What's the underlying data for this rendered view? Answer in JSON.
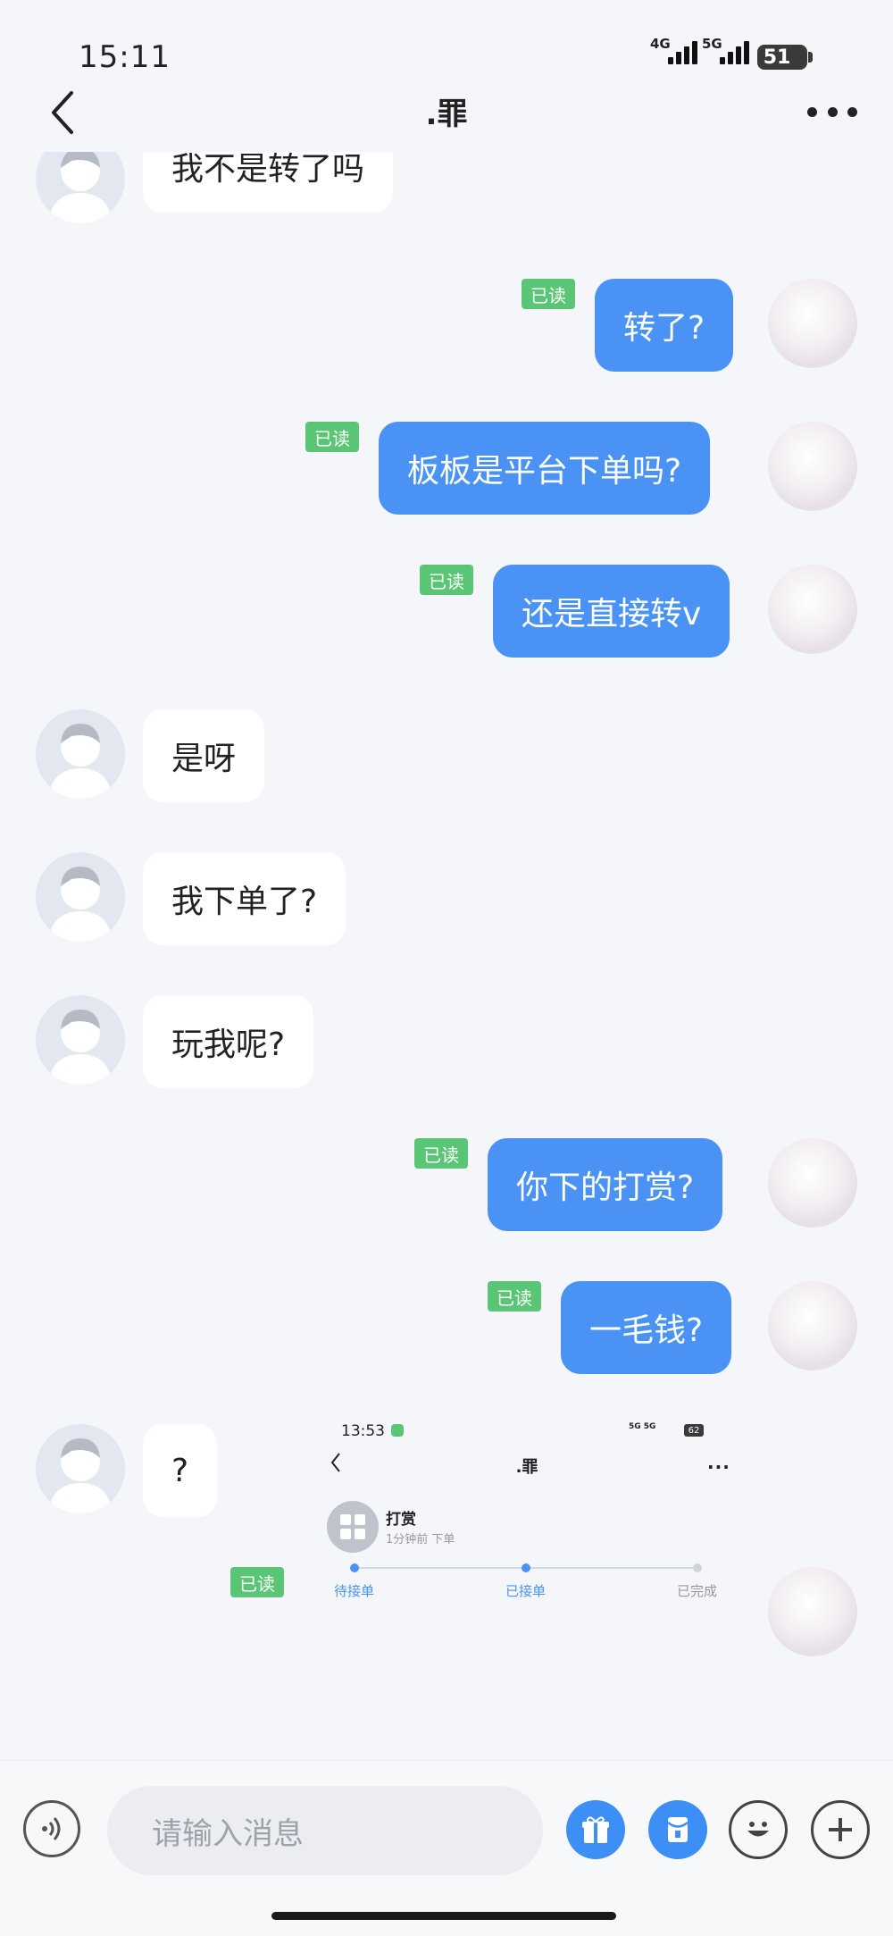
{
  "status": {
    "time": "15:11",
    "net1": "4G",
    "net2": "5G",
    "battery": "51"
  },
  "nav": {
    "title": ".罪"
  },
  "messages": [
    {
      "dir": "in",
      "text": "我不是转了吗"
    },
    {
      "dir": "out",
      "text": "转了?",
      "read": "已读"
    },
    {
      "dir": "out",
      "text": "板板是平台下单吗?",
      "read": "已读"
    },
    {
      "dir": "out",
      "text": "还是直接转v",
      "read": "已读"
    },
    {
      "dir": "in",
      "text": "是呀"
    },
    {
      "dir": "in",
      "text": "我下单了?"
    },
    {
      "dir": "in",
      "text": "玩我呢?"
    },
    {
      "dir": "out",
      "text": "你下的打赏?",
      "read": "已读"
    },
    {
      "dir": "out",
      "text": "一毛钱?",
      "read": "已读"
    },
    {
      "dir": "in",
      "text": "?"
    }
  ],
  "image_message": {
    "read": "已读",
    "time": "13:53",
    "signal": "5G 5G",
    "battery": "62",
    "title": ".罪",
    "item_name": "打赏",
    "item_sub": "1分钟前 下单",
    "steps": [
      "待接单",
      "已接单",
      "已完成"
    ]
  },
  "input": {
    "placeholder": "请输入消息"
  },
  "colors": {
    "accent": "#4a93f5",
    "read_badge": "#5bc576",
    "background": "#f4f6fa"
  },
  "icons": [
    "back-icon",
    "more-icon",
    "voice-icon",
    "gift-icon",
    "red-packet-icon",
    "emoji-icon",
    "plus-icon"
  ]
}
